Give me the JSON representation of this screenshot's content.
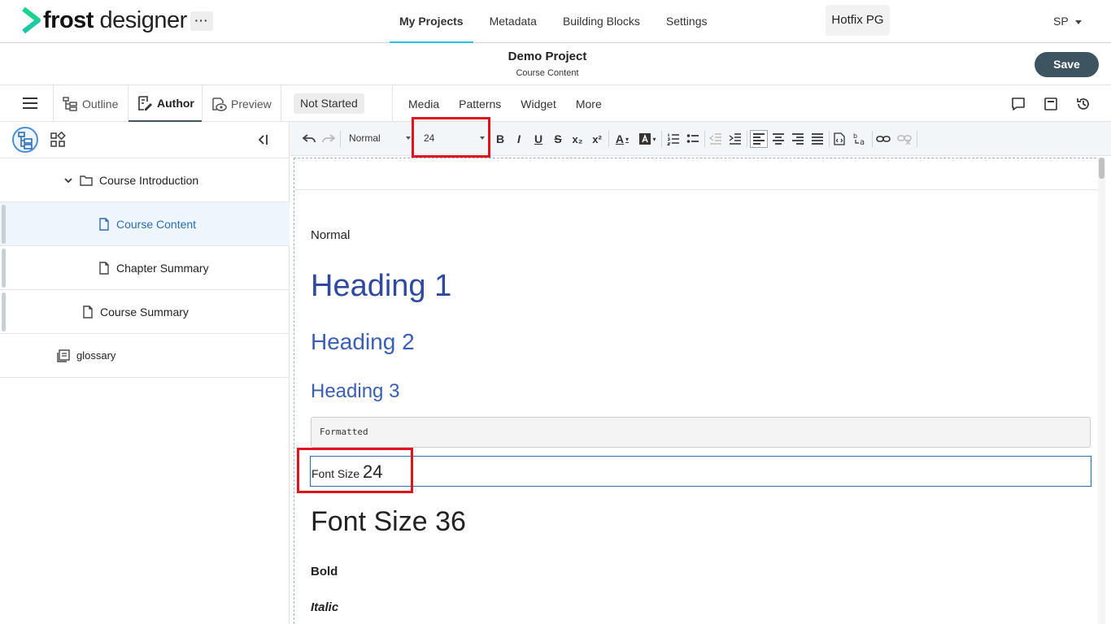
{
  "app": {
    "brand_bold": "frost",
    "brand_rest": " designer",
    "more": "···"
  },
  "nav": {
    "items": [
      "My Projects",
      "Metadata",
      "Building Blocks",
      "Settings"
    ],
    "active": "My Projects"
  },
  "workspace": "Hotfix PG",
  "user": "SP",
  "project": {
    "title": "Demo Project",
    "subtitle": "Course Content",
    "save_label": "Save"
  },
  "modes": {
    "outline": "Outline",
    "author": "Author",
    "preview": "Preview",
    "status": "Not Started"
  },
  "tools_menu": [
    "Media",
    "Patterns",
    "Widget",
    "More"
  ],
  "tree": [
    {
      "label": "Course Introduction",
      "type": "folder",
      "expanded": true
    },
    {
      "label": "Course Content",
      "type": "page",
      "selected": true
    },
    {
      "label": "Chapter Summary",
      "type": "page"
    },
    {
      "label": "Course Summary",
      "type": "page"
    },
    {
      "label": "glossary",
      "type": "glossary"
    }
  ],
  "toolbar": {
    "style_value": "Normal",
    "size_value": "24",
    "bold": "B",
    "italic": "I",
    "underline": "U",
    "strike": "S",
    "subscript": "x₂",
    "superscript": "x²",
    "font_color": "A"
  },
  "content": {
    "normal": "Normal",
    "h1": "Heading 1",
    "h2": "Heading 2",
    "h3": "Heading 3",
    "formatted": "Formatted",
    "fs24_label": "Font Size ",
    "fs24_value": "24",
    "fs36": "Font Size 36",
    "bold": "Bold",
    "italic": "Italic"
  },
  "colors": {
    "accent": "#28c1e2",
    "save_bg": "#3d5560",
    "heading": "#3049a0",
    "highlight_box": "#e0141e",
    "selected_row": "#eef5fd"
  }
}
